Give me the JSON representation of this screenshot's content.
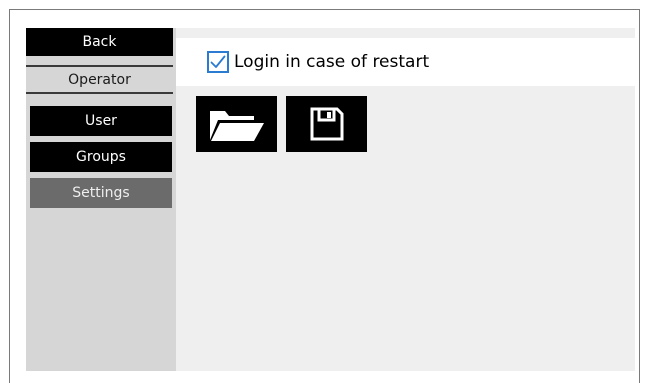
{
  "sidebar": {
    "back_label": "Back",
    "section_title": "Operator",
    "items": [
      {
        "label": "User",
        "active": false
      },
      {
        "label": "Groups",
        "active": false
      },
      {
        "label": "Settings",
        "active": true
      }
    ]
  },
  "settings": {
    "login_on_restart": {
      "label": "Login in case of restart",
      "checked": true
    },
    "toolbar": [
      {
        "icon": "folder-open-icon"
      },
      {
        "icon": "floppy-disk-icon"
      }
    ]
  },
  "colors": {
    "checkbox_accent": "#2b7bd0",
    "active_nav": "#6b6b6b",
    "sidebar_bg": "#d6d6d6",
    "content_bg": "#efefef"
  }
}
